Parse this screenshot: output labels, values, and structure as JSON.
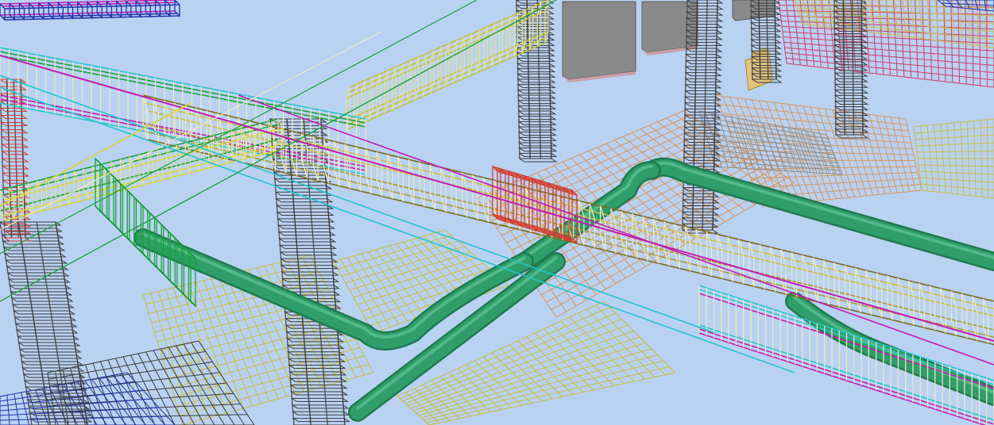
{
  "scene": {
    "background_color": "#b9d2f2",
    "palette": {
      "pipe": "#2f9e6a",
      "pipe_dark": "#1f7a4f",
      "pipe_highlight": "#6fd0a0",
      "stirrup_yellow": "#e4e08a",
      "stirrup_cream": "#ece7c2",
      "mesh_olive": "#c8bd45",
      "mesh_orange": "#d8955a",
      "tie_magenta": "#c21cb0",
      "tie_cyan": "#22c4cc",
      "bar_green": "#19a23a",
      "bar_dark": "#3c3c3c",
      "bar_red": "#d33a2a",
      "bar_blue": "#2233aa",
      "mesh_grey": "#8e8e8e",
      "block_grey": "#8a8a8a",
      "box_tan": "#e3c27a"
    }
  }
}
